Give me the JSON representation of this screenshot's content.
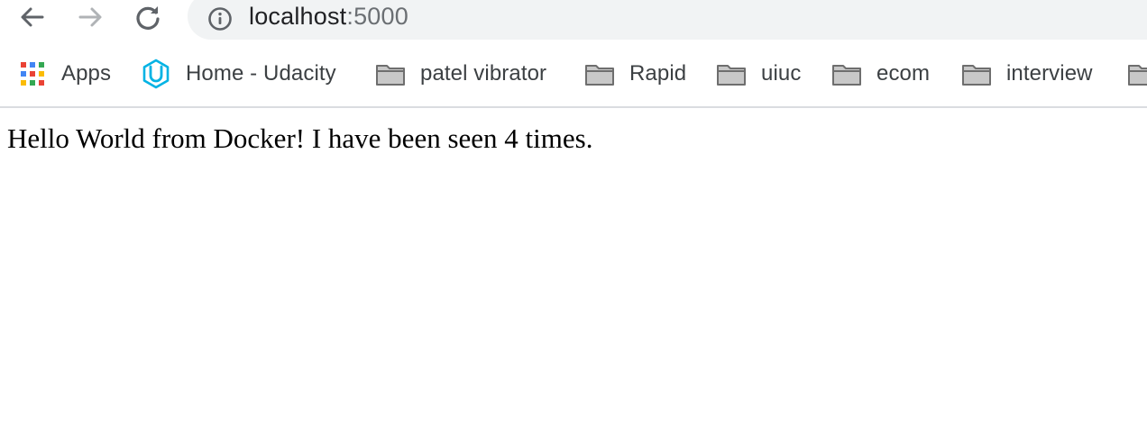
{
  "browser": {
    "nav": {
      "back_icon": "arrow-left-icon",
      "forward_icon": "arrow-right-icon",
      "reload_icon": "reload-icon"
    },
    "address_bar": {
      "host": "localhost",
      "port": ":5000",
      "info_icon": "info-icon"
    },
    "bookmarks": [
      {
        "label": "Apps",
        "icon": "apps-grid-icon"
      },
      {
        "label": "Home - Udacity",
        "icon": "udacity-logo-icon"
      },
      {
        "label": "patel vibrator",
        "icon": "folder-icon"
      },
      {
        "label": "Rapid",
        "icon": "folder-icon"
      },
      {
        "label": "uiuc",
        "icon": "folder-icon"
      },
      {
        "label": "ecom",
        "icon": "folder-icon"
      },
      {
        "label": "interview",
        "icon": "folder-icon"
      }
    ]
  },
  "page": {
    "message": "Hello World from Docker! I have been seen 4 times."
  },
  "colors": {
    "omnibox_bg": "#f1f3f4",
    "bookmark_text": "#3c4043",
    "folder_fill": "#c8c8c8",
    "udacity_blue": "#02b3e4"
  }
}
